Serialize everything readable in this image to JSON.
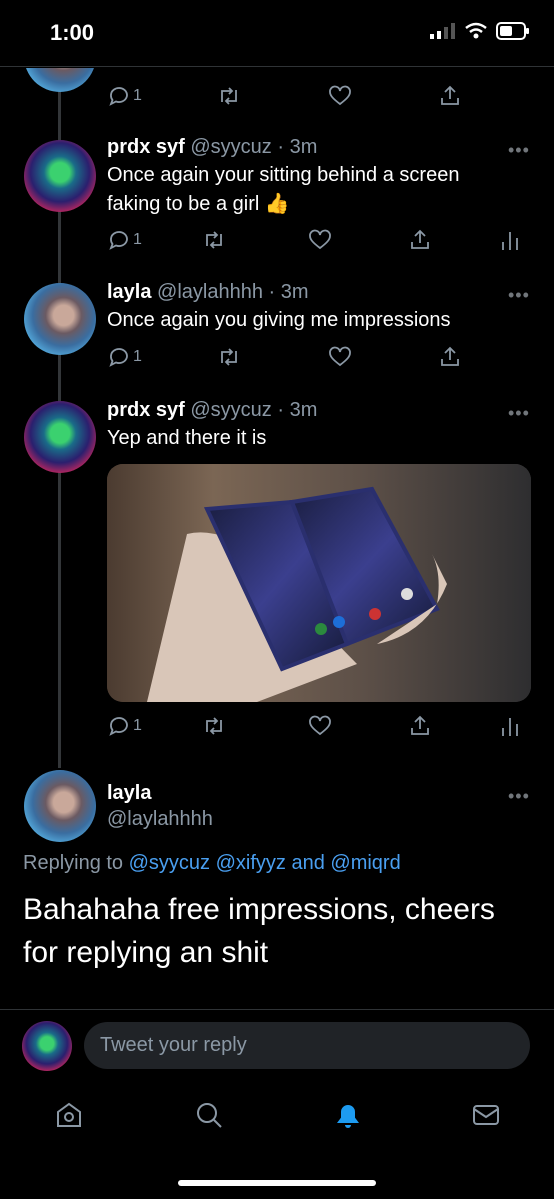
{
  "status_bar": {
    "time": "1:00"
  },
  "tweets": [
    {
      "reply_count": "1"
    },
    {
      "name": "prdx syf",
      "handle": "@syycuz",
      "time": "· 3m",
      "text_line1": "Once again your sitting behind a screen",
      "text_line2": "faking to be a girl 👍",
      "reply_count": "1"
    },
    {
      "name": "layla",
      "handle": "@laylahhhh",
      "time": "· 3m",
      "text_line1": "Once again you giving me impressions",
      "reply_count": "1"
    },
    {
      "name": "prdx syf",
      "handle": "@syycuz",
      "time": "· 3m",
      "text_line1": "Yep and there it is",
      "reply_count": "1"
    }
  ],
  "main_tweet": {
    "name": "layla",
    "handle": "@laylahhhh",
    "replying_prefix": "Replying to",
    "replying_to": "@syycuz @xifyyz and @miqrd",
    "text_line1": "Bahahaha free impressions, cheers",
    "text_line2": "for replying an shit"
  },
  "reply_box": {
    "placeholder": "Tweet your reply"
  },
  "more_glyph": "•••",
  "colors": {
    "background": "#000000",
    "accent": "#1d9bf0",
    "muted": "#8b98a5"
  },
  "icons": [
    "reply-icon",
    "retweet-icon",
    "like-icon",
    "share-icon",
    "analytics-icon",
    "home-icon",
    "search-icon",
    "notifications-icon",
    "messages-icon"
  ]
}
